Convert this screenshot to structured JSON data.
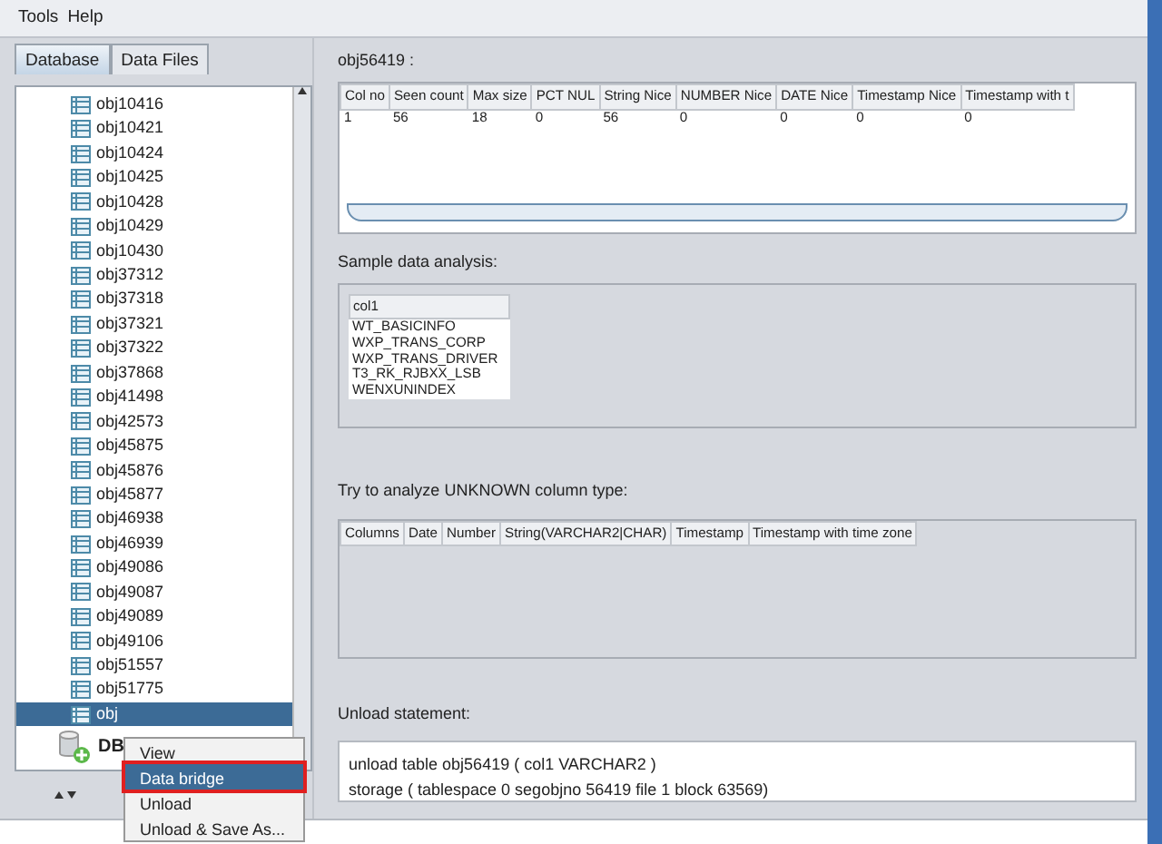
{
  "menu_bar": [
    "Tools",
    "Help"
  ],
  "tabs": [
    {
      "label": "Database",
      "selected": true
    },
    {
      "label": "Data Files",
      "selected": false
    }
  ],
  "tree": {
    "items": [
      {
        "label": "obj10416",
        "selected": false
      },
      {
        "label": "obj10421",
        "selected": false
      },
      {
        "label": "obj10424",
        "selected": false
      },
      {
        "label": "obj10425",
        "selected": false
      },
      {
        "label": "obj10428",
        "selected": false
      },
      {
        "label": "obj10429",
        "selected": false
      },
      {
        "label": "obj10430",
        "selected": false
      },
      {
        "label": "obj37312",
        "selected": false
      },
      {
        "label": "obj37318",
        "selected": false
      },
      {
        "label": "obj37321",
        "selected": false
      },
      {
        "label": "obj37322",
        "selected": false
      },
      {
        "label": "obj37868",
        "selected": false
      },
      {
        "label": "obj41498",
        "selected": false
      },
      {
        "label": "obj42573",
        "selected": false
      },
      {
        "label": "obj45875",
        "selected": false
      },
      {
        "label": "obj45876",
        "selected": false
      },
      {
        "label": "obj45877",
        "selected": false
      },
      {
        "label": "obj46938",
        "selected": false
      },
      {
        "label": "obj46939",
        "selected": false
      },
      {
        "label": "obj49086",
        "selected": false
      },
      {
        "label": "obj49087",
        "selected": false
      },
      {
        "label": "obj49089",
        "selected": false
      },
      {
        "label": "obj49106",
        "selected": false
      },
      {
        "label": "obj51557",
        "selected": false
      },
      {
        "label": "obj51775",
        "selected": false
      },
      {
        "label": "obj",
        "selected": true
      }
    ],
    "db_node": {
      "label": "DB"
    }
  },
  "context_menu": [
    {
      "label": "View",
      "selected": false
    },
    {
      "label": "Data bridge",
      "selected": true
    },
    {
      "label": "Unload",
      "selected": false
    },
    {
      "label": "Unload & Save As...",
      "selected": false
    }
  ],
  "object_title": "obj56419 :",
  "stats_table": {
    "columns": [
      "Col no",
      "Seen count",
      "Max size",
      "PCT NUL",
      "String Nice",
      "NUMBER Nice",
      "DATE Nice",
      "Timestamp Nice",
      "Timestamp with t"
    ],
    "rows": [
      [
        "1",
        "56",
        "18",
        "0",
        "56",
        "0",
        "0",
        "0",
        "0"
      ]
    ]
  },
  "sample_label": "Sample data analysis:",
  "sample_table": {
    "columns": [
      "col1"
    ],
    "rows": [
      [
        "WT_BASICINFO"
      ],
      [
        "WXP_TRANS_CORP"
      ],
      [
        "WXP_TRANS_DRIVER"
      ],
      [
        "T3_RK_RJBXX_LSB"
      ],
      [
        "WENXUNINDEX"
      ]
    ]
  },
  "unknown_label": "Try to analyze UNKNOWN column type:",
  "unknown_table": {
    "columns": [
      "Columns",
      "Date",
      "Number",
      "String(VARCHAR2|CHAR)",
      "Timestamp",
      "Timestamp with time zone"
    ]
  },
  "unload_label": "Unload statement:",
  "unload_statement": [
    "unload table obj56419 ( col1 VARCHAR2 )",
    "storage ( tablespace 0 segobjno 56419 file 1 block 63569)"
  ]
}
